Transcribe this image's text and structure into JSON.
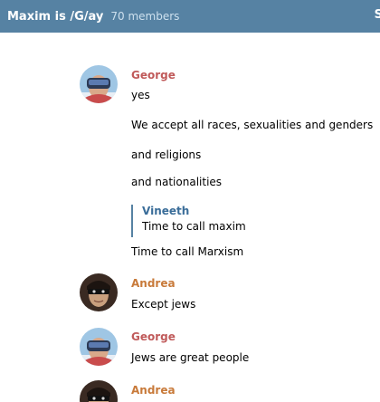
{
  "header": {
    "title": "Maxim is /G/ay",
    "members": "70 members",
    "right_fragment": "S"
  },
  "colors": {
    "header_bg": "#5682a3",
    "george_name": "#c05a5a",
    "andrea_name": "#c87a3a",
    "reply_name": "#3a6d99"
  },
  "messages": [
    {
      "text": ""
    },
    {
      "sender": "George",
      "avatar": "vr-headset-avatar-icon",
      "text": "yes"
    },
    {
      "text": "We accept all races, sexualities and genders"
    },
    {
      "text": "and religions"
    },
    {
      "text": "and nationalities"
    },
    {
      "reply": {
        "name": "Vineeth",
        "text": "Time to call maxim"
      }
    },
    {
      "text": "Time to call Marxism"
    },
    {
      "sender": "Andrea",
      "avatar": "masked-face-avatar-icon",
      "text": "Except jews"
    },
    {
      "sender": "George",
      "avatar": "vr-headset-avatar-icon",
      "text": "Jews are great people"
    },
    {
      "sender": "Andrea",
      "avatar": "masked-face-avatar-icon"
    }
  ]
}
